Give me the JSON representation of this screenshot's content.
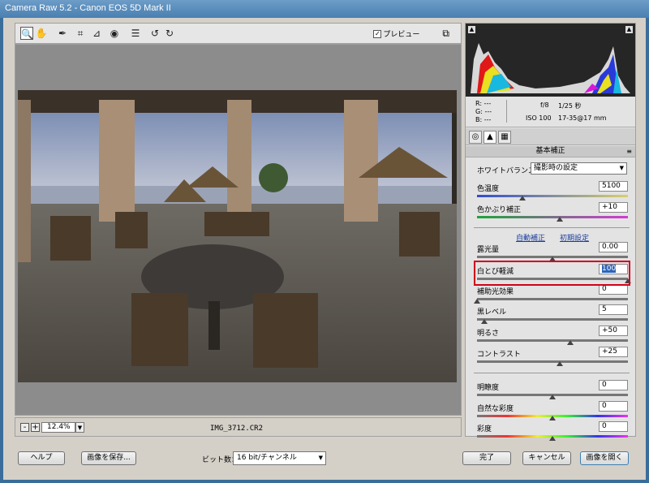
{
  "window": {
    "title": "Camera Raw 5.2  -  Canon EOS 5D Mark II"
  },
  "toolbar": {
    "tools": [
      {
        "name": "zoom-tool",
        "glyph": "🔍"
      },
      {
        "name": "hand-tool",
        "glyph": "✋"
      },
      {
        "name": "white-balance-tool",
        "glyph": "✒"
      },
      {
        "name": "crop-tool",
        "glyph": "⌗"
      },
      {
        "name": "straighten-tool",
        "glyph": "⊿"
      },
      {
        "name": "red-eye-tool",
        "glyph": "◉"
      },
      {
        "name": "preferences-tool",
        "glyph": "☰"
      },
      {
        "name": "rotate-ccw-tool",
        "glyph": "↺"
      },
      {
        "name": "rotate-cw-tool",
        "glyph": "↻"
      }
    ],
    "preview_label": "プレビュー",
    "preview_checked": true,
    "fullscreen_icon": "⧉"
  },
  "status": {
    "zoom_out": "-",
    "zoom_in": "+",
    "zoom_value": "12.4%",
    "filename": "IMG_3712.CR2"
  },
  "bottom": {
    "help": "ヘルプ",
    "save_image": "画像を保存...",
    "bit_depth_label": "ビット数：",
    "bit_depth_value": "16 bit/チャンネル",
    "done": "完了",
    "cancel": "キャンセル",
    "open_image": "画像を開く"
  },
  "readout": {
    "r": "R:   ---",
    "g": "G:   ---",
    "b": "B:   ---",
    "aperture": "f/8",
    "shutter": "1/25 秒",
    "iso": "ISO 100",
    "lens": "17-35@17 mm"
  },
  "panel": {
    "title": "基本補正",
    "menu_icon": "≡",
    "white_balance": {
      "label": "ホワイトバランス：",
      "value": "撮影時の設定"
    },
    "auto_link": "自動補正",
    "default_link": "初期設定",
    "sliders": [
      {
        "label": "色温度",
        "value": "5100",
        "pos": 0.3,
        "gradient": "linear-gradient(90deg,#2f4bd3,#d8d06a)"
      },
      {
        "label": "色かぶり補正",
        "value": "+10",
        "pos": 0.55,
        "gradient": "linear-gradient(90deg,#1ea53a,#d23bd3)"
      },
      {
        "label": "露光量",
        "value": "0.00",
        "pos": 0.5,
        "gradient": "linear-gradient(90deg,#777,#777)"
      },
      {
        "label": "白とび軽減",
        "value": "100",
        "pos": 1.0,
        "gradient": "linear-gradient(90deg,#777,#777)",
        "highlighted": true
      },
      {
        "label": "補助光効果",
        "value": "0",
        "pos": 0.0,
        "gradient": "linear-gradient(90deg,#777,#777)"
      },
      {
        "label": "黒レベル",
        "value": "5",
        "pos": 0.05,
        "gradient": "linear-gradient(90deg,#777,#777)"
      },
      {
        "label": "明るさ",
        "value": "+50",
        "pos": 0.62,
        "gradient": "linear-gradient(90deg,#777,#777)"
      },
      {
        "label": "コントラスト",
        "value": "+25",
        "pos": 0.55,
        "gradient": "linear-gradient(90deg,#777,#777)"
      },
      {
        "label": "明瞭度",
        "value": "0",
        "pos": 0.5,
        "gradient": "linear-gradient(90deg,#777,#777)"
      },
      {
        "label": "自然な彩度",
        "value": "0",
        "pos": 0.5,
        "gradient": "linear-gradient(90deg,#777,#e33 20%,#ee3 40%,#3e3 60%,#33e 80%,#e3e)"
      },
      {
        "label": "彩度",
        "value": "0",
        "pos": 0.5,
        "gradient": "linear-gradient(90deg,#777,#e33 20%,#ee3 40%,#3e3 60%,#33e 80%,#e3e)"
      }
    ]
  },
  "colors": {
    "highlight_border": "#d0021b",
    "accent": "#3c7fb1"
  }
}
